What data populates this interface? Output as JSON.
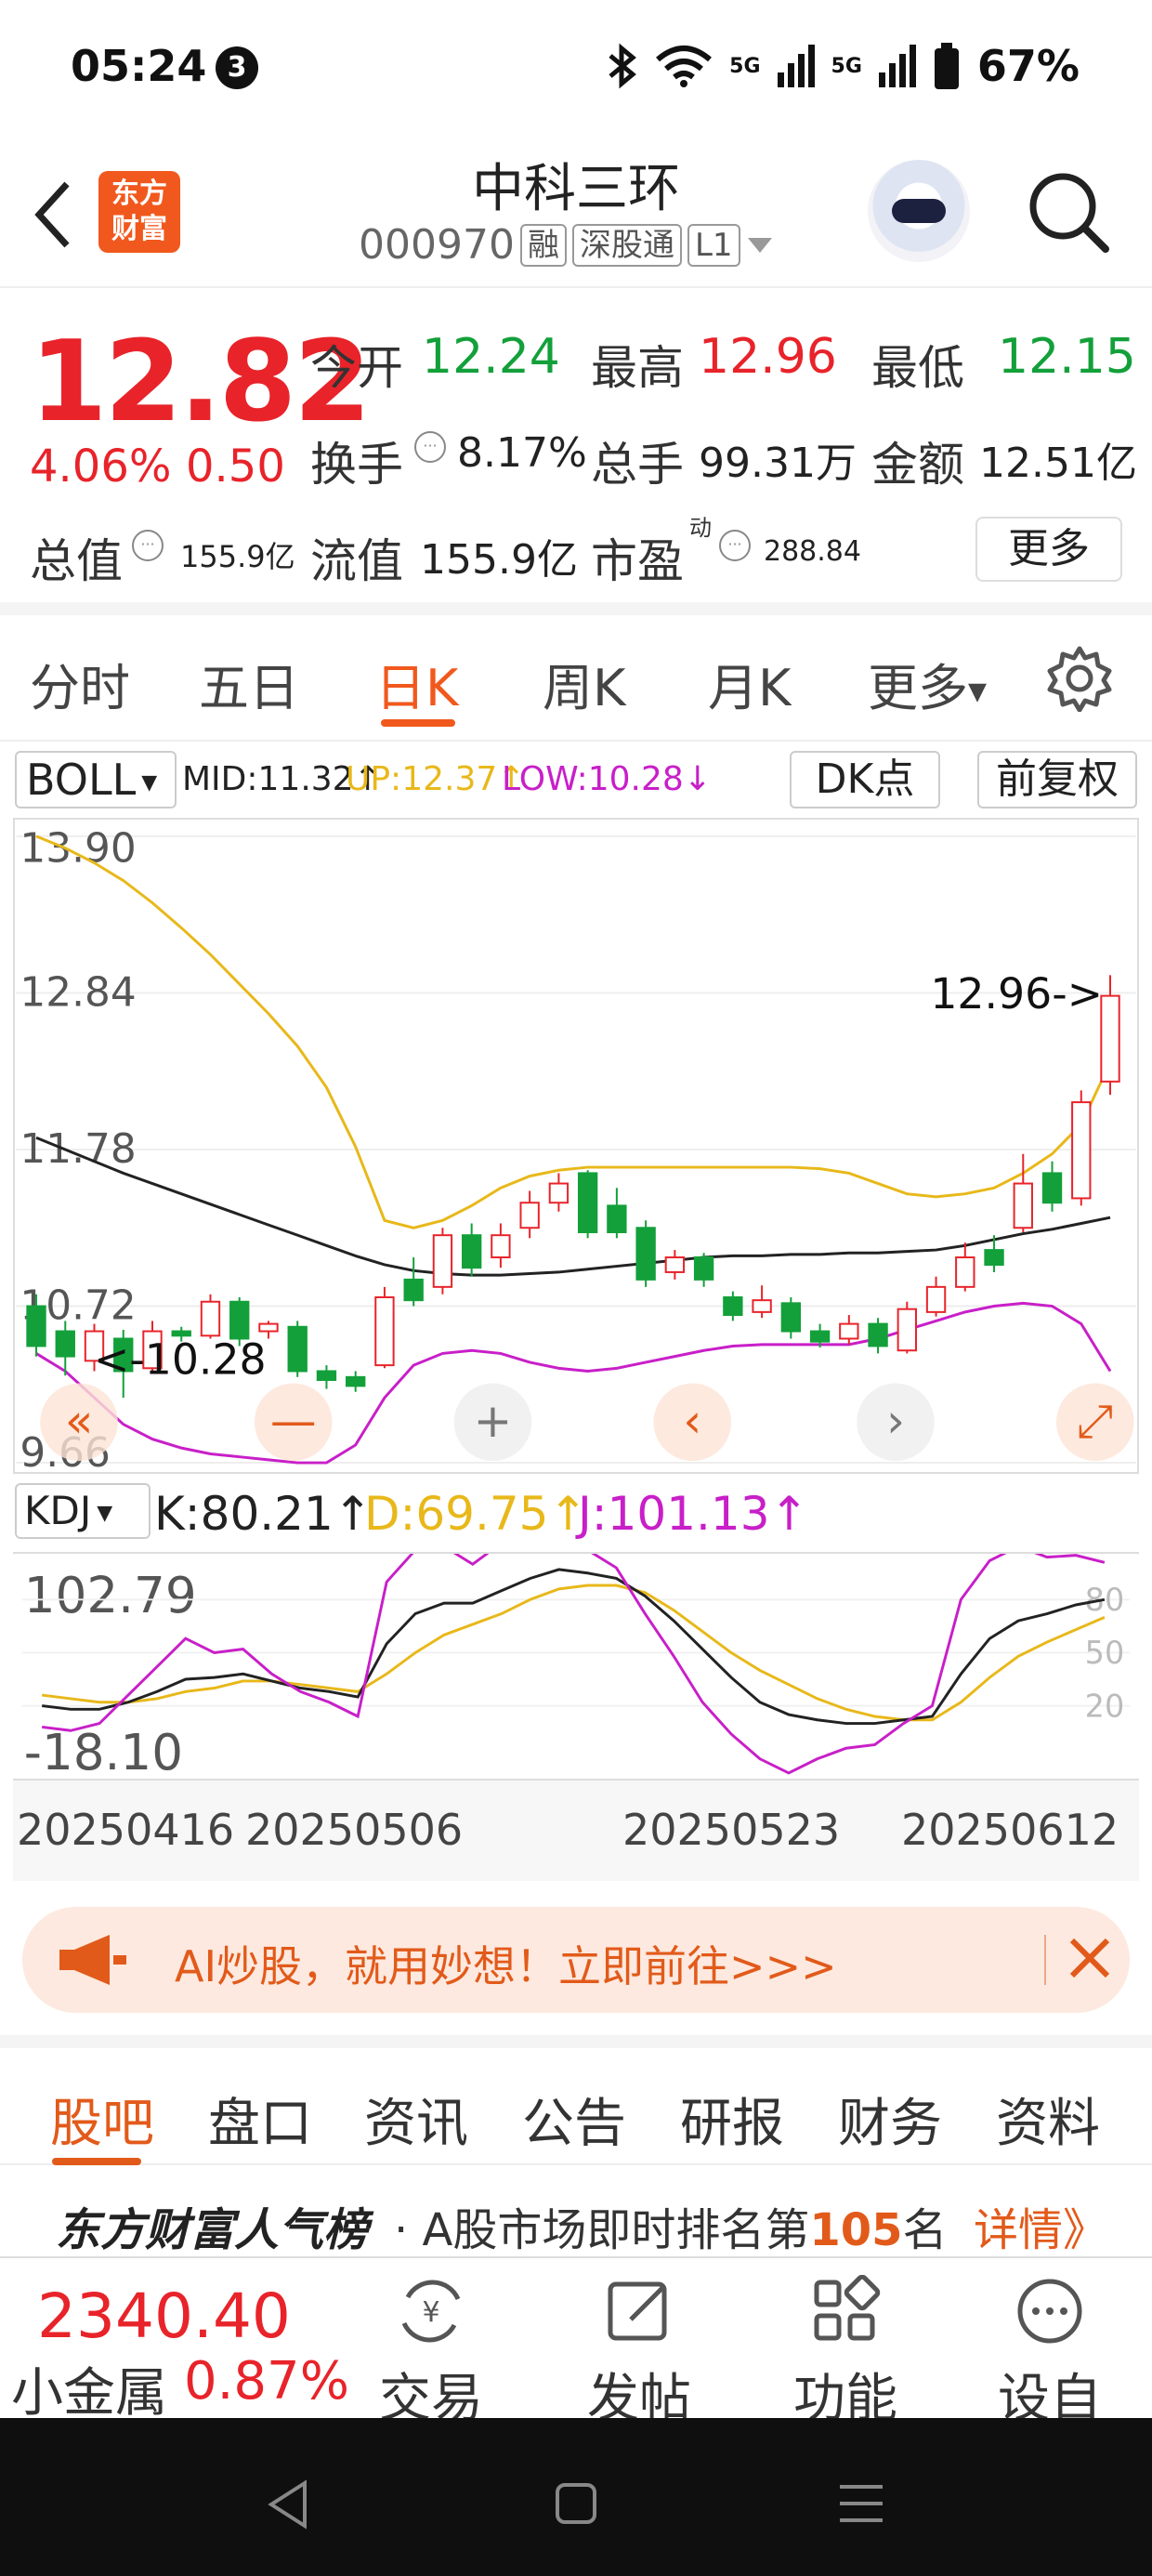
{
  "status_bar": {
    "time": "05:24",
    "notification_count": "3",
    "network": "5G",
    "battery": "67%"
  },
  "header": {
    "title": "中科三环",
    "code": "000970",
    "tags": [
      "融",
      "深股通",
      "L1"
    ],
    "logo_text": "东方财富"
  },
  "quote": {
    "price": "12.82",
    "change_pct": "4.06%",
    "change": "0.50",
    "open_label": "今开",
    "open": "12.24",
    "high_label": "最高",
    "high": "12.96",
    "low_label": "最低",
    "low": "12.15",
    "turnover_label": "换手",
    "turnover": "8.17%",
    "volume_label": "总手",
    "volume": "99.31万",
    "amount_label": "金额",
    "amount": "12.51亿",
    "mktcap_label": "总值",
    "mktcap": "155.9亿",
    "float_label": "流值",
    "float_cap": "155.9亿",
    "pe_label": "市盈",
    "pe_sup": "动",
    "pe": "288.84",
    "more": "更多"
  },
  "period_tabs": [
    "分时",
    "五日",
    "日K",
    "周K",
    "月K",
    "更多"
  ],
  "active_period": "日K",
  "indicator": {
    "name": "BOLL",
    "mid": "MID:11.32↑",
    "up": "UP:12.37↑",
    "low": "LOW:10.28↓",
    "dk_button": "DK点",
    "adjust_button": "前复权"
  },
  "kdj": {
    "name": "KDJ",
    "k": "K:80.21↑",
    "d": "D:69.75↑",
    "j": "J:101.13↑"
  },
  "chart_labels": {
    "max_marker": "12.96->",
    "min_marker": "<-10.28",
    "kdj_top": "102.79",
    "kdj_bottom": "-18.10"
  },
  "chart_data": {
    "type": "candlestick",
    "ylim": [
      9.66,
      13.9
    ],
    "yticks": [
      "13.90",
      "12.84",
      "11.78",
      "10.72",
      "9.66"
    ],
    "kdj_levels": [
      "80",
      "50",
      "20"
    ],
    "dates": [
      "20250416",
      "20250506",
      "20250523",
      "20250612"
    ],
    "candles": [
      {
        "o": 10.72,
        "c": 10.45,
        "h": 10.8,
        "l": 10.38
      },
      {
        "o": 10.55,
        "c": 10.38,
        "h": 10.62,
        "l": 10.25
      },
      {
        "o": 10.35,
        "c": 10.55,
        "h": 10.6,
        "l": 10.28
      },
      {
        "o": 10.5,
        "c": 10.28,
        "h": 10.56,
        "l": 10.1
      },
      {
        "o": 10.3,
        "c": 10.55,
        "h": 10.62,
        "l": 10.28
      },
      {
        "o": 10.55,
        "c": 10.52,
        "h": 10.58,
        "l": 10.48
      },
      {
        "o": 10.52,
        "c": 10.75,
        "h": 10.8,
        "l": 10.5
      },
      {
        "o": 10.75,
        "c": 10.5,
        "h": 10.78,
        "l": 10.45
      },
      {
        "o": 10.55,
        "c": 10.6,
        "h": 10.62,
        "l": 10.5
      },
      {
        "o": 10.58,
        "c": 10.28,
        "h": 10.62,
        "l": 10.24
      },
      {
        "o": 10.28,
        "c": 10.22,
        "h": 10.32,
        "l": 10.16
      },
      {
        "o": 10.24,
        "c": 10.18,
        "h": 10.28,
        "l": 10.14
      },
      {
        "o": 10.32,
        "c": 10.78,
        "h": 10.85,
        "l": 10.3
      },
      {
        "o": 10.9,
        "c": 10.76,
        "h": 11.05,
        "l": 10.72
      },
      {
        "o": 10.85,
        "c": 11.2,
        "h": 11.25,
        "l": 10.8
      },
      {
        "o": 11.2,
        "c": 10.98,
        "h": 11.28,
        "l": 10.92
      },
      {
        "o": 11.05,
        "c": 11.2,
        "h": 11.28,
        "l": 10.98
      },
      {
        "o": 11.25,
        "c": 11.42,
        "h": 11.5,
        "l": 11.18
      },
      {
        "o": 11.42,
        "c": 11.55,
        "h": 11.62,
        "l": 11.36
      },
      {
        "o": 11.62,
        "c": 11.22,
        "h": 11.64,
        "l": 11.18
      },
      {
        "o": 11.4,
        "c": 11.22,
        "h": 11.52,
        "l": 11.18
      },
      {
        "o": 11.25,
        "c": 10.9,
        "h": 11.3,
        "l": 10.85
      },
      {
        "o": 10.95,
        "c": 11.05,
        "h": 11.1,
        "l": 10.9
      },
      {
        "o": 11.05,
        "c": 10.9,
        "h": 11.08,
        "l": 10.85
      },
      {
        "o": 10.78,
        "c": 10.66,
        "h": 10.82,
        "l": 10.62
      },
      {
        "o": 10.68,
        "c": 10.76,
        "h": 10.86,
        "l": 10.64
      },
      {
        "o": 10.74,
        "c": 10.55,
        "h": 10.78,
        "l": 10.5
      },
      {
        "o": 10.55,
        "c": 10.48,
        "h": 10.6,
        "l": 10.44
      },
      {
        "o": 10.5,
        "c": 10.6,
        "h": 10.66,
        "l": 10.46
      },
      {
        "o": 10.6,
        "c": 10.45,
        "h": 10.64,
        "l": 10.4
      },
      {
        "o": 10.42,
        "c": 10.7,
        "h": 10.75,
        "l": 10.4
      },
      {
        "o": 10.68,
        "c": 10.85,
        "h": 10.92,
        "l": 10.65
      },
      {
        "o": 10.85,
        "c": 11.05,
        "h": 11.15,
        "l": 10.82
      },
      {
        "o": 11.1,
        "c": 11.0,
        "h": 11.2,
        "l": 10.95
      },
      {
        "o": 11.25,
        "c": 11.55,
        "h": 11.75,
        "l": 11.22
      },
      {
        "o": 11.62,
        "c": 11.42,
        "h": 11.7,
        "l": 11.36
      },
      {
        "o": 11.45,
        "c": 12.1,
        "h": 12.18,
        "l": 11.4
      },
      {
        "o": 12.24,
        "c": 12.82,
        "h": 12.96,
        "l": 12.15
      }
    ],
    "mid": [
      11.86,
      11.78,
      11.7,
      11.62,
      11.55,
      11.48,
      11.41,
      11.34,
      11.27,
      11.2,
      11.13,
      11.06,
      11.0,
      10.96,
      10.94,
      10.93,
      10.93,
      10.94,
      10.95,
      10.97,
      10.99,
      11.01,
      11.03,
      11.05,
      11.06,
      11.06,
      11.07,
      11.07,
      11.08,
      11.08,
      11.09,
      11.1,
      11.13,
      11.17,
      11.21,
      11.24,
      11.28,
      11.32
    ],
    "up": [
      13.9,
      13.82,
      13.72,
      13.6,
      13.45,
      13.28,
      13.1,
      12.9,
      12.7,
      12.48,
      12.2,
      11.8,
      11.3,
      11.25,
      11.3,
      11.4,
      11.52,
      11.6,
      11.64,
      11.66,
      11.66,
      11.66,
      11.66,
      11.66,
      11.66,
      11.66,
      11.66,
      11.65,
      11.62,
      11.55,
      11.48,
      11.46,
      11.48,
      11.52,
      11.62,
      11.75,
      11.95,
      12.37
    ],
    "low": [
      10.4,
      10.28,
      10.1,
      9.92,
      9.82,
      9.76,
      9.72,
      9.7,
      9.68,
      9.66,
      9.66,
      9.78,
      10.1,
      10.32,
      10.4,
      10.42,
      10.4,
      10.34,
      10.3,
      10.28,
      10.3,
      10.34,
      10.38,
      10.42,
      10.45,
      10.46,
      10.46,
      10.46,
      10.46,
      10.5,
      10.56,
      10.62,
      10.68,
      10.72,
      10.74,
      10.72,
      10.6,
      10.28
    ],
    "kdj_k": [
      20,
      18,
      18,
      22,
      28,
      35,
      36,
      38,
      34,
      30,
      28,
      25,
      55,
      72,
      78,
      78,
      85,
      92,
      97,
      95,
      92,
      82,
      68,
      52,
      36,
      22,
      15,
      12,
      10,
      10,
      12,
      14,
      38,
      58,
      68,
      72,
      77,
      80
    ],
    "kdj_d": [
      26,
      24,
      22,
      22,
      24,
      28,
      30,
      34,
      34,
      32,
      30,
      28,
      38,
      50,
      60,
      66,
      72,
      80,
      86,
      88,
      88,
      84,
      74,
      62,
      50,
      40,
      32,
      24,
      18,
      14,
      12,
      12,
      22,
      36,
      48,
      56,
      63,
      70
    ],
    "kdj_j": [
      8,
      6,
      10,
      26,
      42,
      58,
      50,
      52,
      38,
      28,
      22,
      14,
      90,
      108,
      110,
      100,
      112,
      118,
      120,
      108,
      98,
      72,
      48,
      22,
      4,
      -10,
      -18,
      -10,
      -4,
      -2,
      10,
      20,
      80,
      102,
      110,
      104,
      105,
      101
    ]
  },
  "banner": {
    "text": "AI炒股，就用妙想！立即前往>>>"
  },
  "news_tabs": [
    "股吧",
    "盘口",
    "资讯",
    "公告",
    "研报",
    "财务",
    "资料"
  ],
  "active_news_tab": "股吧",
  "popularity": {
    "brand": "东方财富人气榜",
    "text": "· A股市场即时排名第",
    "rank": "105",
    "suffix": "名",
    "link": "详情》"
  },
  "toolbar": {
    "index_value": "2340.40",
    "index_name": "小金属",
    "index_change": "0.87%",
    "items": [
      "交易",
      "发帖",
      "功能",
      "设自选"
    ]
  },
  "colors": {
    "up": "#e8232a",
    "down": "#13a03a",
    "accent": "#f1581d",
    "mid_line": "#222222",
    "up_line": "#e8b81a",
    "low_line": "#c81fc8"
  }
}
